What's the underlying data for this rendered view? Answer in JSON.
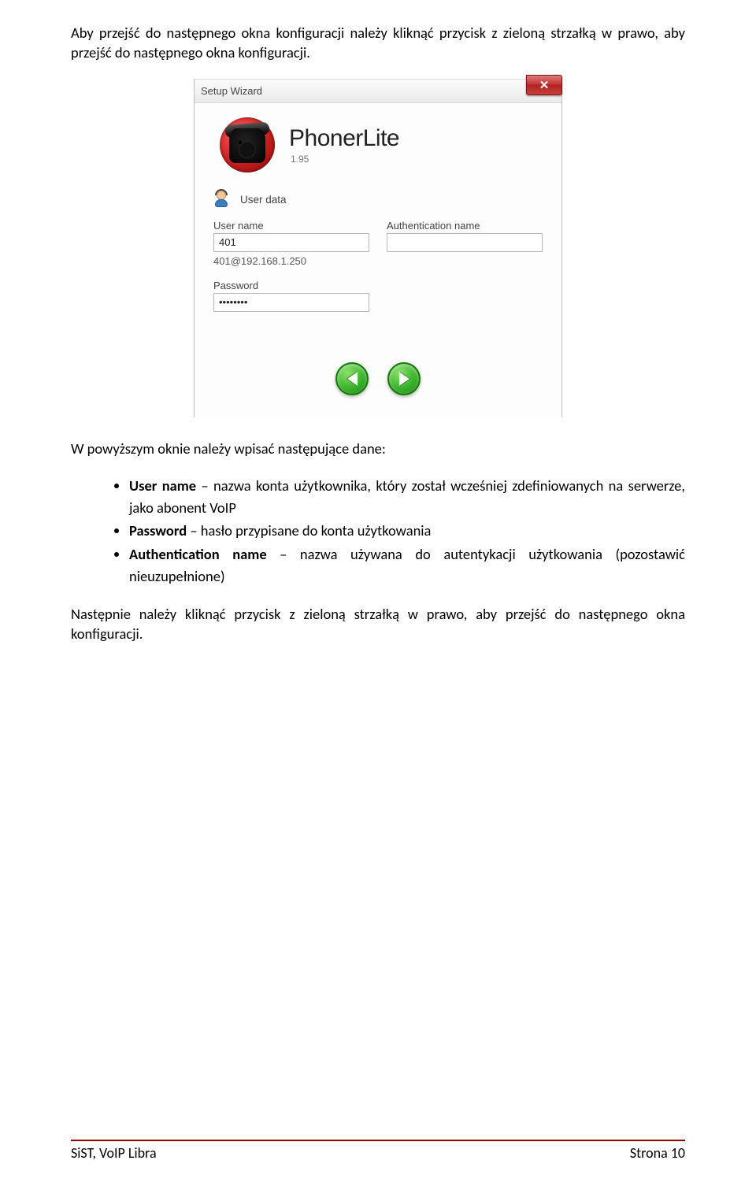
{
  "para1": "Aby przejść do następnego okna konfiguracji należy kliknąć przycisk z zieloną strzałką w prawo, aby przejść do następnego okna konfiguracji.",
  "wizard": {
    "title": "Setup Wizard",
    "close": "✕",
    "brand": "PhonerLite",
    "version": "1.95",
    "section": "User data",
    "fields": {
      "username_label": "User name",
      "username_value": "401",
      "username_sub": "401@192.168.1.250",
      "authname_label": "Authentication name",
      "authname_value": "",
      "password_label": "Password",
      "password_value": "••••••••"
    }
  },
  "para2": "W powyższym oknie należy wpisać następujące dane:",
  "bullets": {
    "b1_key": "User name",
    "b1_rest": " – nazwa konta użytkownika, który został wcześniej zdefiniowanych na serwerze, jako abonent VoIP",
    "b2_key": "Password",
    "b2_rest": " – hasło przypisane do konta użytkowania",
    "b3_key": "Authentication name",
    "b3_rest": " – nazwa używana do autentykacji użytkowania (pozostawić nieuzupełnione)"
  },
  "para3": "Następnie należy kliknąć przycisk z zieloną strzałką w prawo, aby przejść do następnego okna konfiguracji.",
  "footer": {
    "left": "SiST, VoIP Libra",
    "right": "Strona 10"
  }
}
